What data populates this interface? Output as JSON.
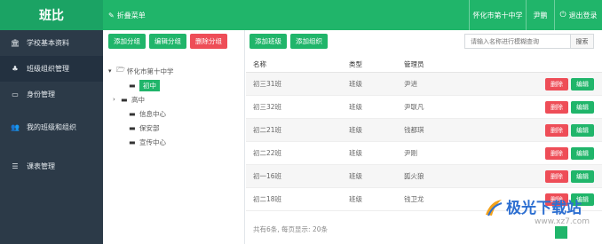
{
  "header": {
    "brand": "班比",
    "collapse_label": "折叠菜单",
    "org_name": "怀化市第十中学",
    "user_name": "尹鹏",
    "logout_label": "退出登录"
  },
  "sidebar": {
    "items": [
      {
        "label": "学校基本资料",
        "icon": "bank-icon"
      },
      {
        "label": "班级组织管理",
        "icon": "org-icon"
      },
      {
        "label": "身份管理",
        "icon": "card-icon"
      },
      {
        "label": "我的班级和组织",
        "icon": "group-icon"
      },
      {
        "label": "课表管理",
        "icon": "list-icon"
      }
    ]
  },
  "tree_toolbar": {
    "add_group": "添加分组",
    "edit_group": "编辑分组",
    "delete_group": "删除分组"
  },
  "tree": {
    "root": "怀化市第十中学",
    "nodes": [
      "初中",
      "高中",
      "信息中心",
      "保安部",
      "宣传中心"
    ]
  },
  "main_toolbar": {
    "add_class": "添加班级",
    "add_org": "添加组织"
  },
  "search": {
    "placeholder": "请输入名称进行模糊查询",
    "button": "搜索"
  },
  "table": {
    "headers": {
      "name": "名称",
      "type": "类型",
      "admin": "管理员"
    },
    "delete_label": "删除",
    "edit_label": "编辑",
    "rows": [
      {
        "name": "初三31班",
        "type": "班级",
        "admin": "尹进"
      },
      {
        "name": "初三32班",
        "type": "班级",
        "admin": "尹联凡"
      },
      {
        "name": "初二21班",
        "type": "班级",
        "admin": "钱都琪"
      },
      {
        "name": "初二22班",
        "type": "班级",
        "admin": "尹刚"
      },
      {
        "name": "初一16班",
        "type": "班级",
        "admin": "狐火狼"
      },
      {
        "name": "初二18班",
        "type": "班级",
        "admin": "钱卫龙"
      }
    ]
  },
  "footer": {
    "summary": "共有6条,   每页显示: 20条"
  },
  "watermark": {
    "title": "极光下载站",
    "url": "www.xz7.com"
  },
  "colors": {
    "accent": "#20b56a",
    "danger": "#ee4d57",
    "sidebar": "#2c3a48"
  }
}
